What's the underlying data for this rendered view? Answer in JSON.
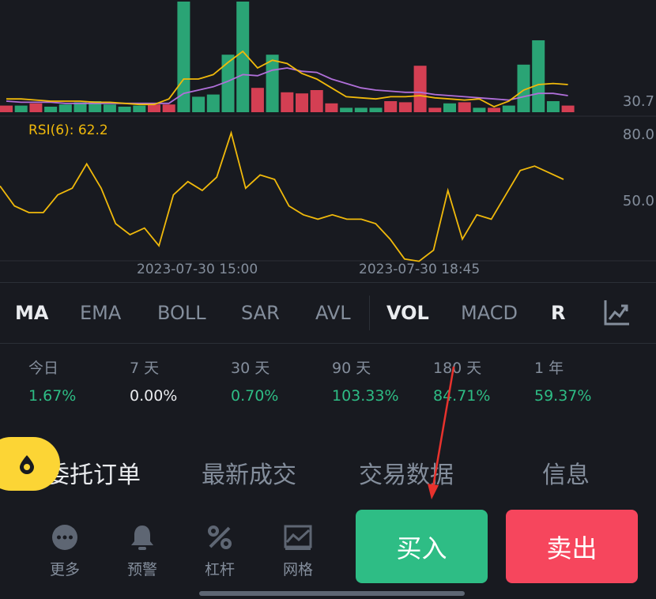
{
  "chart": {
    "price_top": "",
    "price_bottom": "30.7",
    "rsi_label": "RSI(6): 62.2",
    "rsi_levels": [
      "80.0",
      "50.0"
    ],
    "time_labels": [
      "2023-07-30 15:00",
      "2023-07-30 18:45"
    ],
    "volume_bars": [
      {
        "v": 0.06,
        "up": false
      },
      {
        "v": 0.06,
        "up": true
      },
      {
        "v": 0.08,
        "up": false
      },
      {
        "v": 0.05,
        "up": true
      },
      {
        "v": 0.07,
        "up": true
      },
      {
        "v": 0.09,
        "up": true
      },
      {
        "v": 0.1,
        "up": true
      },
      {
        "v": 0.07,
        "up": true
      },
      {
        "v": 0.05,
        "up": true
      },
      {
        "v": 0.06,
        "up": true
      },
      {
        "v": 0.07,
        "up": false
      },
      {
        "v": 0.07,
        "up": false
      },
      {
        "v": 1.0,
        "up": true
      },
      {
        "v": 0.14,
        "up": true
      },
      {
        "v": 0.16,
        "up": true
      },
      {
        "v": 0.52,
        "up": true
      },
      {
        "v": 1.0,
        "up": true
      },
      {
        "v": 0.22,
        "up": false
      },
      {
        "v": 0.52,
        "up": true
      },
      {
        "v": 0.18,
        "up": false
      },
      {
        "v": 0.17,
        "up": false
      },
      {
        "v": 0.2,
        "up": false
      },
      {
        "v": 0.08,
        "up": false
      },
      {
        "v": 0.04,
        "up": true
      },
      {
        "v": 0.04,
        "up": true
      },
      {
        "v": 0.04,
        "up": true
      },
      {
        "v": 0.1,
        "up": false
      },
      {
        "v": 0.09,
        "up": false
      },
      {
        "v": 0.42,
        "up": false
      },
      {
        "v": 0.04,
        "up": false
      },
      {
        "v": 0.08,
        "up": true
      },
      {
        "v": 0.09,
        "up": false
      },
      {
        "v": 0.04,
        "up": true
      },
      {
        "v": 0.04,
        "up": false
      },
      {
        "v": 0.06,
        "up": true
      },
      {
        "v": 0.43,
        "up": true
      },
      {
        "v": 0.65,
        "up": true
      },
      {
        "v": 0.1,
        "up": true
      },
      {
        "v": 0.06,
        "up": false
      }
    ],
    "ma_yellow": [
      0.12,
      0.12,
      0.11,
      0.1,
      0.1,
      0.1,
      0.09,
      0.09,
      0.08,
      0.07,
      0.07,
      0.12,
      0.3,
      0.3,
      0.34,
      0.45,
      0.55,
      0.4,
      0.47,
      0.44,
      0.35,
      0.3,
      0.22,
      0.14,
      0.13,
      0.12,
      0.14,
      0.14,
      0.15,
      0.13,
      0.12,
      0.11,
      0.12,
      0.05,
      0.1,
      0.2,
      0.25,
      0.26,
      0.25
    ],
    "ma_purple": [
      0.1,
      0.09,
      0.09,
      0.09,
      0.08,
      0.08,
      0.08,
      0.08,
      0.08,
      0.08,
      0.08,
      0.08,
      0.17,
      0.2,
      0.23,
      0.28,
      0.34,
      0.33,
      0.38,
      0.4,
      0.37,
      0.36,
      0.3,
      0.26,
      0.22,
      0.2,
      0.19,
      0.18,
      0.18,
      0.16,
      0.15,
      0.14,
      0.13,
      0.12,
      0.11,
      0.14,
      0.17,
      0.17,
      0.15
    ],
    "rsi_series": [
      57,
      48,
      45,
      45,
      53,
      56,
      67,
      56,
      40,
      35,
      38,
      30,
      53,
      59,
      55,
      61,
      81,
      56,
      62,
      60,
      48,
      44,
      42,
      44,
      42,
      42,
      40,
      33,
      24,
      23,
      28,
      55,
      33,
      44,
      42,
      53,
      64,
      66,
      63,
      60
    ],
    "colors": {
      "up": "#2ebd85",
      "down": "#f6465d",
      "ma_yellow": "#f0b90b",
      "ma_purple": "#b06fd9",
      "rsi": "#f0b90b"
    }
  },
  "indicators": {
    "tabs": [
      {
        "label": "MA",
        "active": true
      },
      {
        "label": "EMA",
        "active": false
      },
      {
        "label": "BOLL",
        "active": false
      },
      {
        "label": "SAR",
        "active": false
      },
      {
        "label": "AVL",
        "active": false
      },
      {
        "label": "VOL",
        "active": true
      },
      {
        "label": "MACD",
        "active": false
      },
      {
        "label": "R",
        "active": true
      }
    ],
    "settings_icon": "chart-settings-icon"
  },
  "performance": [
    {
      "label": "今日",
      "value": "1.67%",
      "color": "#2ebd85"
    },
    {
      "label": "7 天",
      "value": "0.00%",
      "color": "#eaecef"
    },
    {
      "label": "30 天",
      "value": "0.70%",
      "color": "#2ebd85"
    },
    {
      "label": "90 天",
      "value": "103.33%",
      "color": "#2ebd85"
    },
    {
      "label": "180 天",
      "value": "84.71%",
      "color": "#2ebd85"
    },
    {
      "label": "1 年",
      "value": "59.37%",
      "color": "#2ebd85"
    }
  ],
  "bottom_tabs": [
    {
      "label": "委托订单",
      "active": true
    },
    {
      "label": "最新成交",
      "active": false
    },
    {
      "label": "交易数据",
      "active": false
    },
    {
      "label": "信息",
      "active": false
    }
  ],
  "actions": [
    {
      "label": "更多",
      "icon": "more-icon"
    },
    {
      "label": "预警",
      "icon": "bell-icon"
    },
    {
      "label": "杠杆",
      "icon": "percent-icon"
    },
    {
      "label": "网格",
      "icon": "grid-chart-icon"
    }
  ],
  "buy_label": "买入",
  "sell_label": "卖出",
  "fab_icon": "drop-icon",
  "annotation": {
    "type": "red arrow",
    "color": "#e8322d"
  }
}
